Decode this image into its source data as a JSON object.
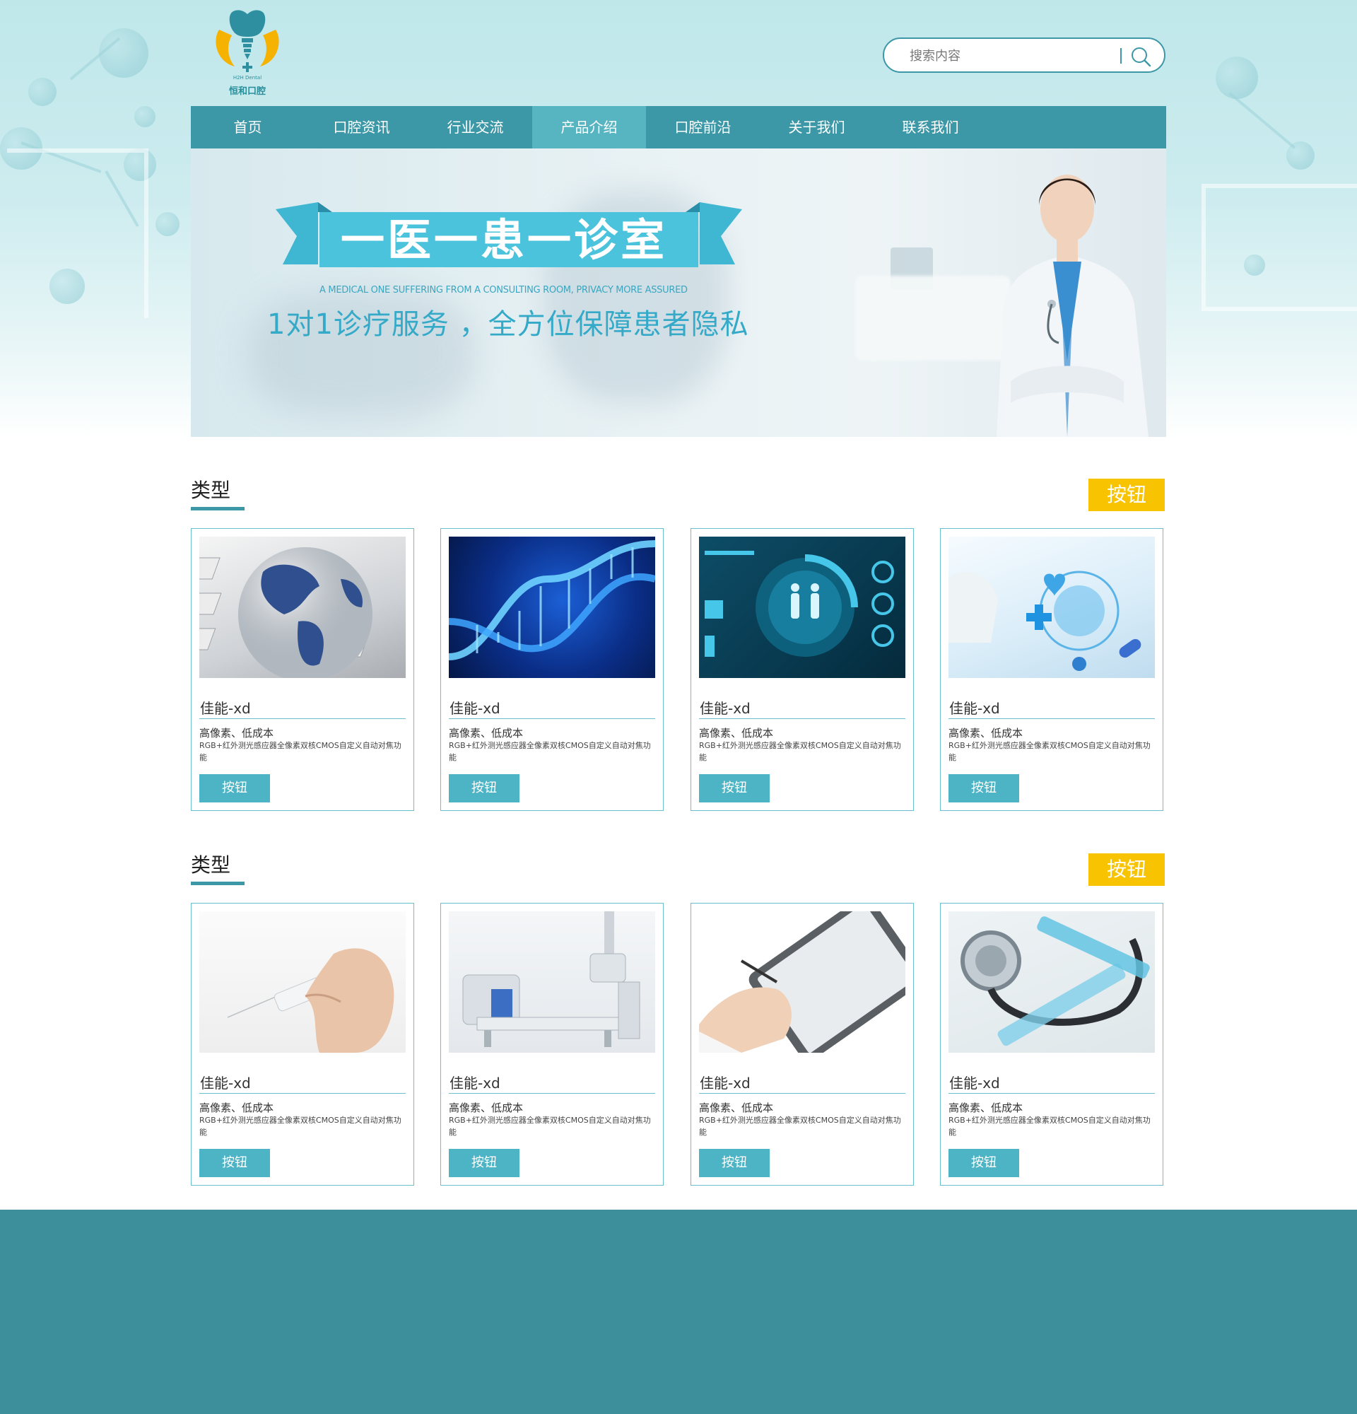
{
  "brand": {
    "name": "恒和口腔",
    "sub": "H2H Dental"
  },
  "search": {
    "placeholder": "搜索内容"
  },
  "nav": {
    "items": [
      {
        "label": "首页"
      },
      {
        "label": "口腔资讯"
      },
      {
        "label": "行业交流"
      },
      {
        "label": "产品介绍",
        "active": true
      },
      {
        "label": "口腔前沿"
      },
      {
        "label": "关于我们"
      },
      {
        "label": "联系我们"
      }
    ]
  },
  "banner": {
    "title": "一医一患一诊室",
    "subtitle_en": "A MEDICAL ONE SUFFERING FROM A CONSULTING ROOM, PRIVACY MORE ASSURED",
    "subtitle": "1对1诊疗服务 ，全方位保障患者隐私"
  },
  "sections": [
    {
      "title": "类型",
      "button": "按钮",
      "cards": [
        {
          "image": "globe-keyboard-image",
          "name": "佳能-xd",
          "sub": "高像素、低成本",
          "desc": "RGB+红外测光感应器全像素双核CMOS自定义自动对焦功能",
          "button": "按钮"
        },
        {
          "image": "dna-helix-image",
          "name": "佳能-xd",
          "sub": "高像素、低成本",
          "desc": "RGB+红外测光感应器全像素双核CMOS自定义自动对焦功能",
          "button": "按钮"
        },
        {
          "image": "health-dashboard-image",
          "name": "佳能-xd",
          "sub": "高像素、低成本",
          "desc": "RGB+红外测光感应器全像素双核CMOS自定义自动对焦功能",
          "button": "按钮"
        },
        {
          "image": "medical-hologram-image",
          "name": "佳能-xd",
          "sub": "高像素、低成本",
          "desc": "RGB+红外测光感应器全像素双核CMOS自定义自动对焦功能",
          "button": "按钮"
        }
      ]
    },
    {
      "title": "类型",
      "button": "按钮",
      "cards": [
        {
          "image": "syringe-hand-image",
          "name": "佳能-xd",
          "sub": "高像素、低成本",
          "desc": "RGB+红外测光感应器全像素双核CMOS自定义自动对焦功能",
          "button": "按钮"
        },
        {
          "image": "xray-machine-image",
          "name": "佳能-xd",
          "sub": "高像素、低成本",
          "desc": "RGB+红外测光感应器全像素双核CMOS自定义自动对焦功能",
          "button": "按钮"
        },
        {
          "image": "tablet-doctor-image",
          "name": "佳能-xd",
          "sub": "高像素、低成本",
          "desc": "RGB+红外测光感应器全像素双核CMOS自定义自动对焦功能",
          "button": "按钮"
        },
        {
          "image": "stethoscope-syringes-image",
          "name": "佳能-xd",
          "sub": "高像素、低成本",
          "desc": "RGB+红外测光感应器全像素双核CMOS自定义自动对焦功能",
          "button": "按钮"
        }
      ]
    }
  ],
  "colors": {
    "primary": "#3c97a6",
    "nav_active": "#57b5c2",
    "accent_yellow": "#f8c300",
    "card_button": "#4db4c5",
    "footer": "#3c8f9b"
  }
}
